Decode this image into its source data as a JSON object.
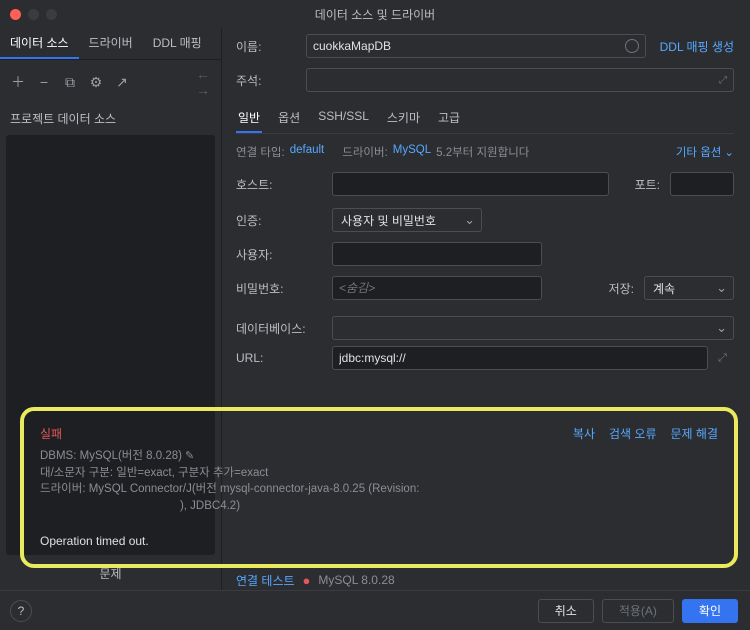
{
  "window": {
    "title": "데이터 소스 및 드라이버"
  },
  "sidebar": {
    "tabs": [
      "데이터 소스",
      "드라이버",
      "DDL 매핑"
    ],
    "section_title": "프로젝트 데이터 소스",
    "bottom_label": "문제"
  },
  "header": {
    "name_label": "이름:",
    "name_value": "cuokkaMapDB",
    "ddl_link": "DDL 매핑 생성",
    "comment_label": "주석:"
  },
  "tabs": [
    "일반",
    "옵션",
    "SSH/SSL",
    "스키마",
    "고급"
  ],
  "meta": {
    "conn_type_label": "연결 타입:",
    "conn_type_value": "default",
    "driver_label": "드라이버:",
    "driver_value": "MySQL",
    "driver_note": "5.2부터 지원합니다",
    "more_options": "기타 옵션"
  },
  "form": {
    "host_label": "호스트:",
    "port_label": "포트:",
    "auth_label": "인증:",
    "auth_value": "사용자 및 비밀번호",
    "user_label": "사용자:",
    "password_label": "비밀번호:",
    "password_placeholder": "<숨김>",
    "save_label": "저장:",
    "save_value": "계속",
    "database_label": "데이터베이스:",
    "url_label": "URL:",
    "url_value": "jdbc:mysql://"
  },
  "fail_box": {
    "title": "실패",
    "links": [
      "복사",
      "검색 오류",
      "문제 해결"
    ],
    "line1_prefix": "DBMS: ",
    "line1_value": "MySQL(버전 8.0.28)",
    "line2": "대/소문자 구분: 일반=exact, 구분자 추가=exact",
    "line3": "드라이버: MySQL Connector/J(버전 mysql-connector-java-8.0.25 (Revision:",
    "line4": "), JDBC4.2)",
    "operation": "Operation timed out."
  },
  "test_row": {
    "label": "연결 테스트",
    "version": "MySQL 8.0.28"
  },
  "footer": {
    "cancel": "취소",
    "apply": "적용(A)",
    "ok": "확인"
  }
}
